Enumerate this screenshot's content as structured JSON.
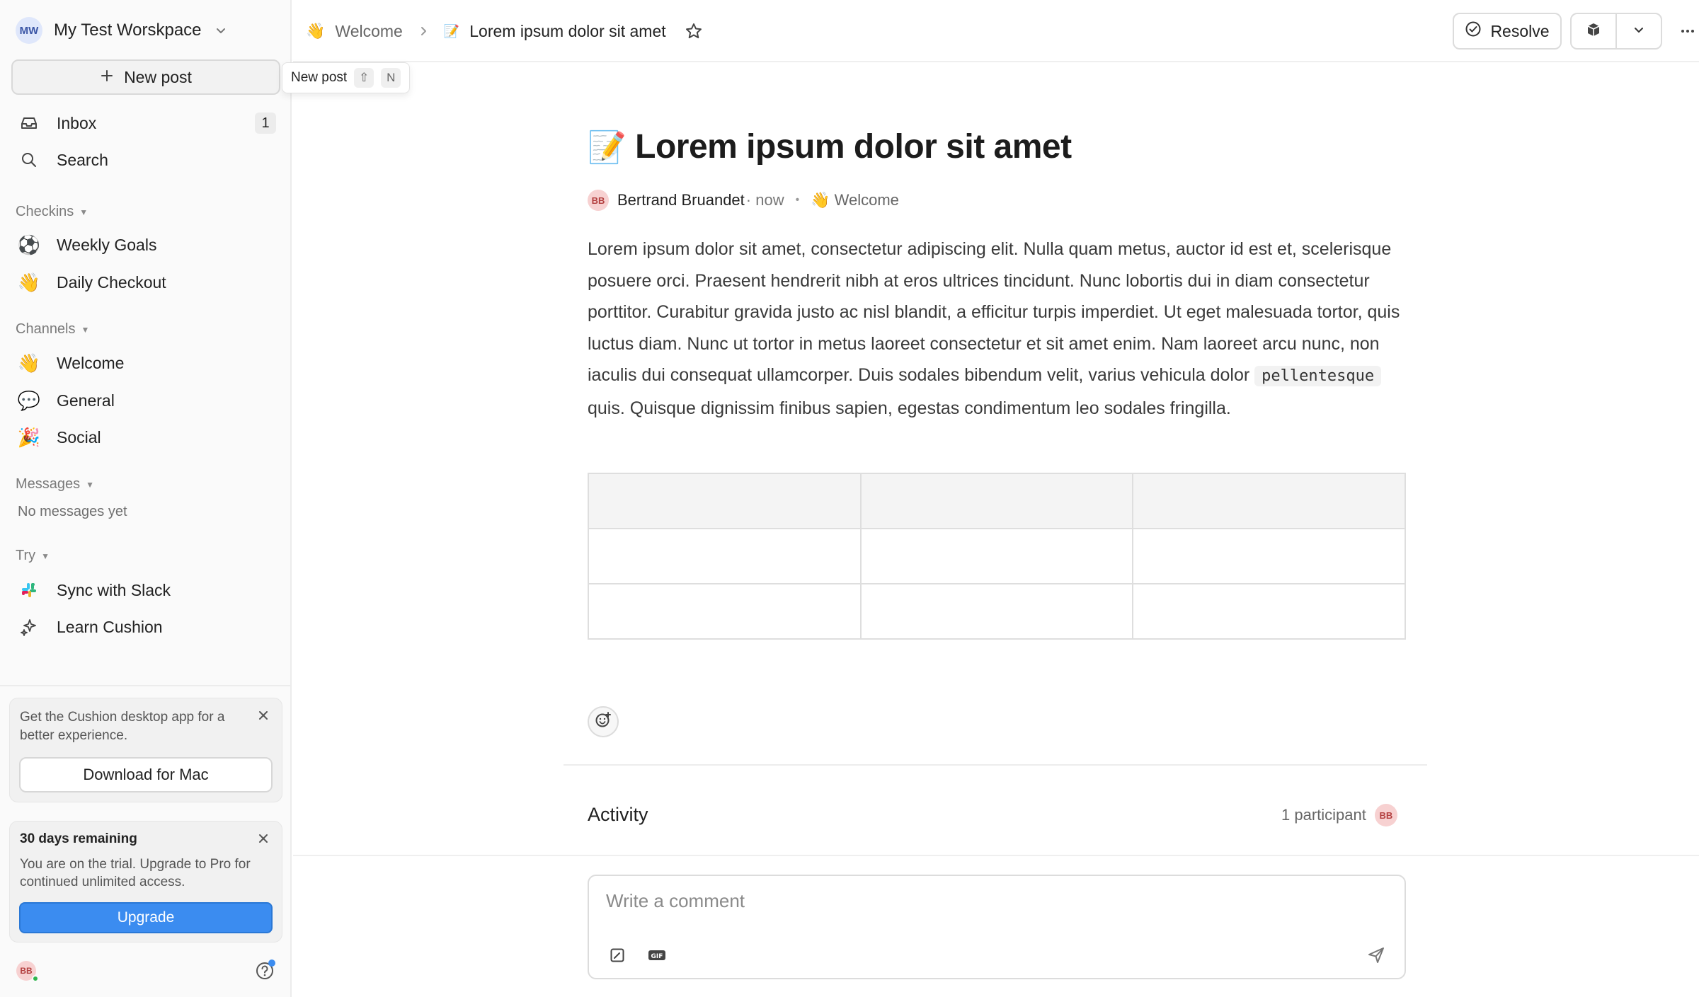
{
  "workspace": {
    "avatar_initials": "MW",
    "name": "My Test Worskpace"
  },
  "sidebar": {
    "new_post_label": "New post",
    "tooltip": {
      "label": "New post",
      "shortcut_shift": "⇧",
      "shortcut_key": "N"
    },
    "inbox": {
      "label": "Inbox",
      "count": "1"
    },
    "search": {
      "label": "Search"
    },
    "sections": {
      "checkins": {
        "label": "Checkins",
        "items": [
          {
            "label": "Weekly Goals",
            "icon": "⚽"
          },
          {
            "label": "Daily Checkout",
            "icon": "👋"
          }
        ]
      },
      "channels": {
        "label": "Channels",
        "items": [
          {
            "label": "Welcome",
            "icon": "👋"
          },
          {
            "label": "General",
            "icon": "💬"
          },
          {
            "label": "Social",
            "icon": "🎉"
          }
        ]
      },
      "messages": {
        "label": "Messages",
        "empty": "No messages yet"
      },
      "try": {
        "label": "Try",
        "items": [
          {
            "label": "Sync with Slack",
            "icon": "slack-icon"
          },
          {
            "label": "Learn Cushion",
            "icon": "sparkle-icon"
          }
        ]
      }
    },
    "promo": {
      "text": "Get the Cushion desktop app for a better experience.",
      "button": "Download for Mac"
    },
    "trial": {
      "title": "30 days remaining",
      "text": "You are on the trial. Upgrade to Pro for continued unlimited access.",
      "button": "Upgrade"
    },
    "user_initials": "BB"
  },
  "topbar": {
    "breadcrumb": {
      "channel_icon": "👋",
      "channel": "Welcome",
      "post_icon": "📝",
      "post": "Lorem ipsum dolor sit amet"
    },
    "resolve_label": "Resolve"
  },
  "post": {
    "icon": "📝",
    "title": "Lorem ipsum dolor sit amet",
    "author_initials": "BB",
    "author": "Bertrand Bruandet",
    "time": "· now",
    "channel_icon": "👋",
    "channel": "Welcome",
    "body_part1": "Lorem ipsum dolor sit amet, consectetur adipiscing elit. Nulla quam metus, auctor id est et, scelerisque posuere orci. Praesent hendrerit nibh at eros ultrices tincidunt. Nunc lobortis dui in diam consectetur porttitor. Curabitur gravida justo ac nisl blandit, a efficitur turpis imperdiet. Ut eget malesuada tortor, quis luctus diam. Nunc ut tortor in metus laoreet consectetur et sit amet enim. Nam laoreet arcu nunc, non iaculis dui consequat ullamcorper. Duis sodales bibendum velit, varius vehicula dolor",
    "body_code": "pellentesque",
    "body_part2": "quis. Quisque dignissim finibus sapien, egestas condimentum leo sodales fringilla."
  },
  "activity": {
    "title": "Activity",
    "participants_label": "1 participant",
    "participant_initials": "BB"
  },
  "composer": {
    "placeholder": "Write a comment"
  },
  "colors": {
    "accent": "#3b8cf0",
    "avatar_bg": "#f7d1d1",
    "online": "#2fb54d"
  }
}
